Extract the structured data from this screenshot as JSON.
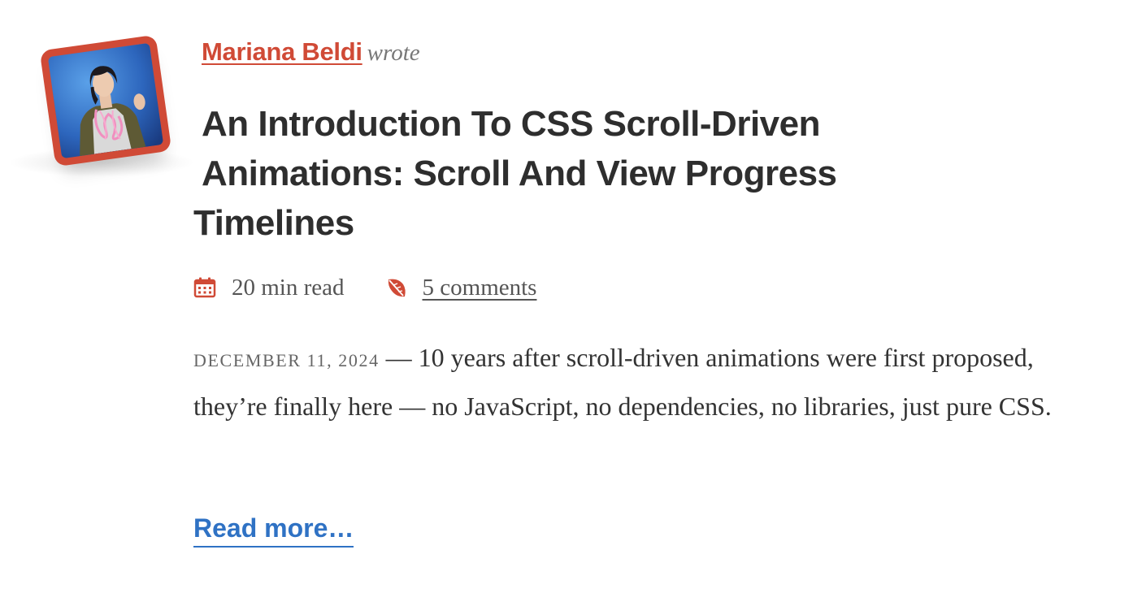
{
  "article": {
    "author_name": "Mariana Beldi",
    "byline_suffix": "wrote",
    "title_line1": "An Introduction To CSS Scroll-Driven",
    "title_line2": "Animations: Scroll And View Progress",
    "title_line3": "Timelines",
    "read_time": "20 min read",
    "comments": "5 comments",
    "date": "December 11, 2024",
    "separator": " — ",
    "excerpt": "10 years after scroll-driven animations were first proposed, they’re finally here — no JavaScript, no dependencies, no libraries, just pure CSS.",
    "read_more": "Read more…"
  },
  "icons": {
    "read_time": "calendar-icon",
    "comments": "comment-leaf-icon"
  },
  "colors": {
    "accent": "#d04a36",
    "link": "#2f72c4",
    "text": "#333333",
    "muted": "#777777"
  }
}
